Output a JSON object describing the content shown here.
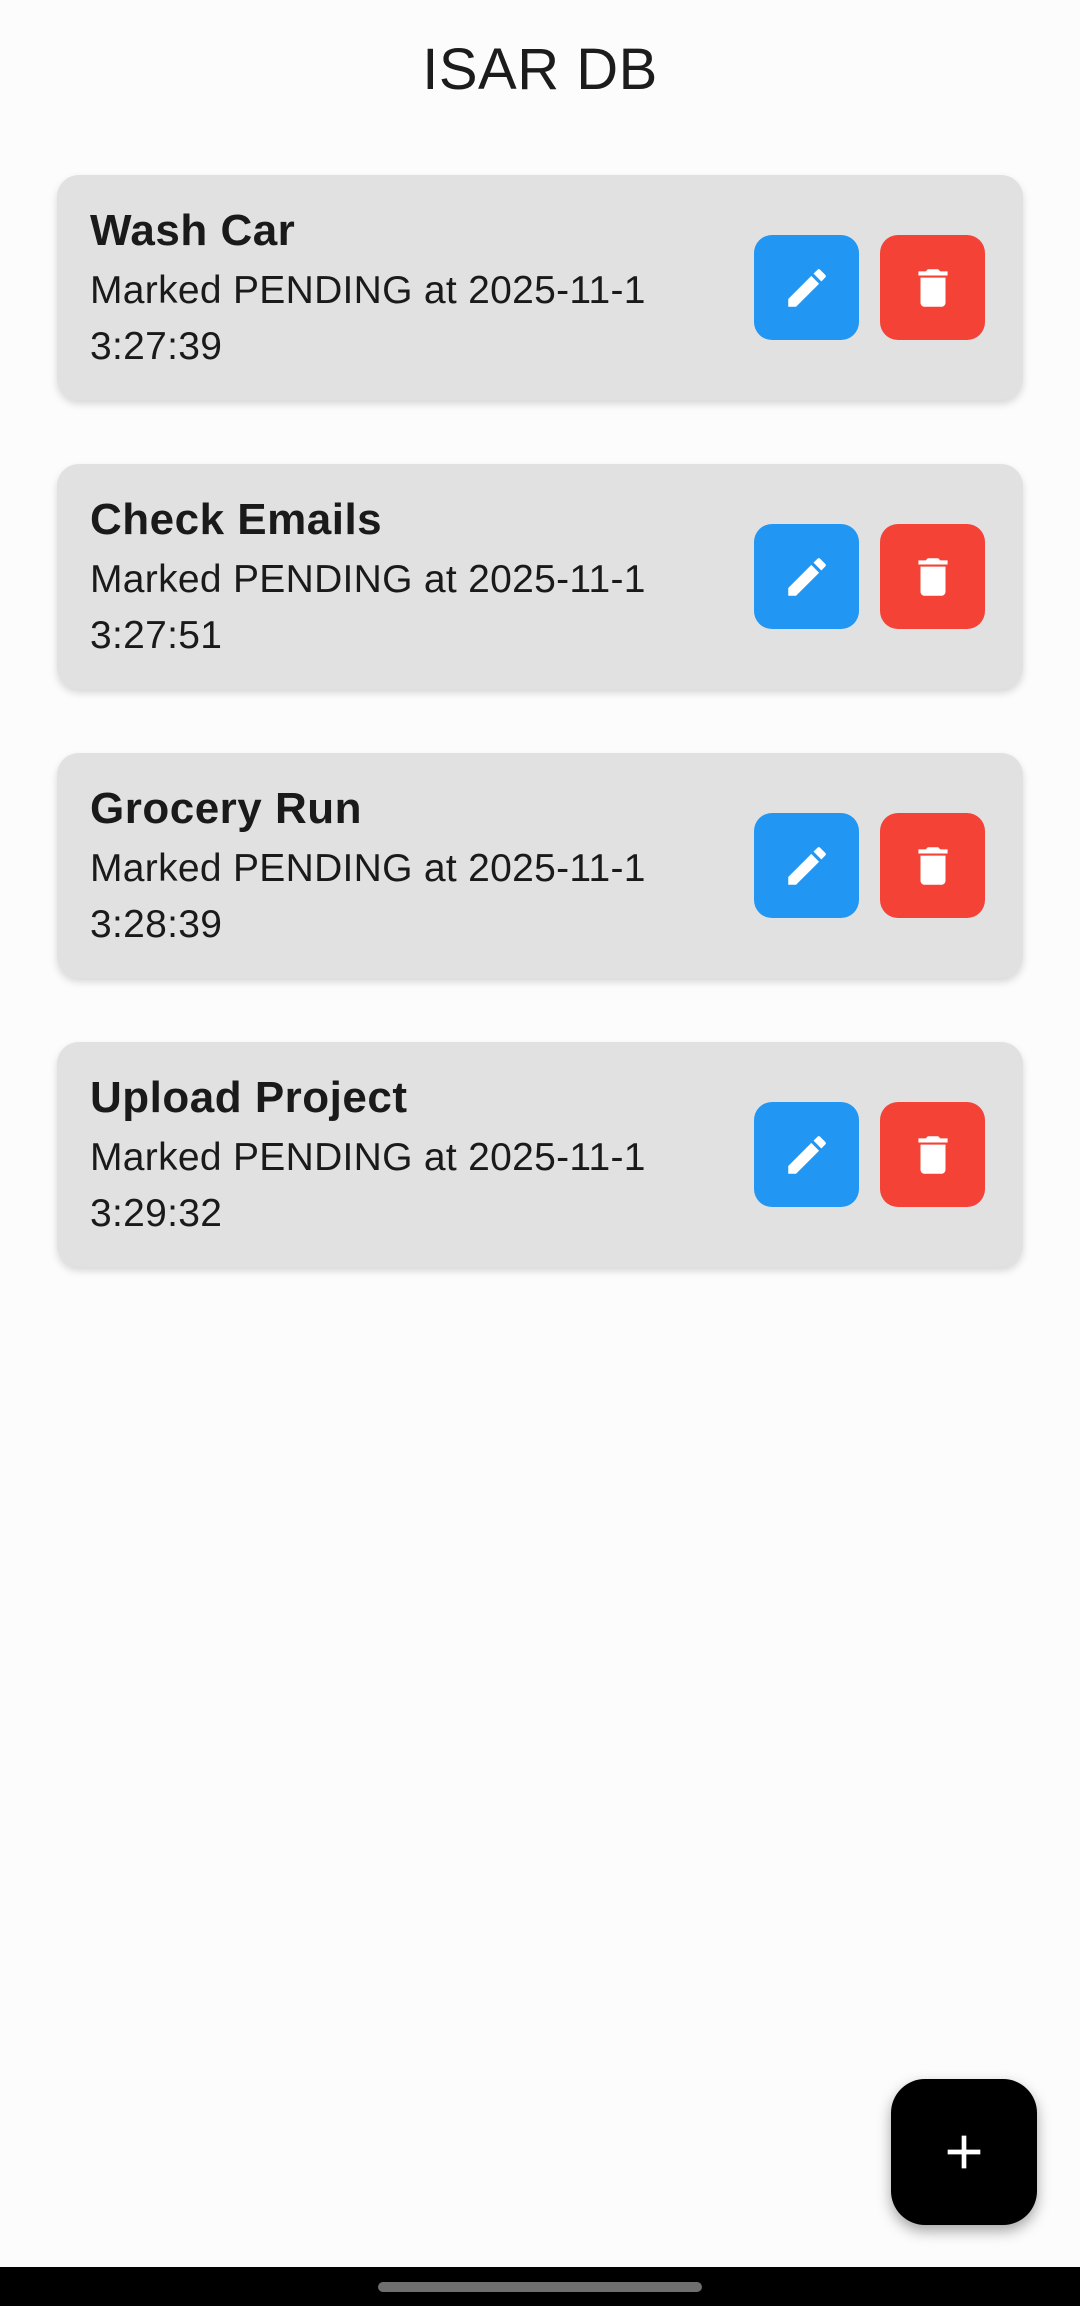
{
  "app": {
    "title": "ISAR DB"
  },
  "tasks": [
    {
      "title": "Wash Car",
      "subtitle": "Marked PENDING at 2025-11-1 3:27:39"
    },
    {
      "title": "Check Emails",
      "subtitle": "Marked PENDING at 2025-11-1 3:27:51"
    },
    {
      "title": "Grocery Run",
      "subtitle": "Marked PENDING at 2025-11-1 3:28:39"
    },
    {
      "title": "Upload Project",
      "subtitle": "Marked PENDING at 2025-11-1 3:29:32"
    }
  ],
  "icons": {
    "edit": "pencil-icon",
    "delete": "trash-icon",
    "add": "plus-icon"
  },
  "colors": {
    "edit_button": "#2196f3",
    "delete_button": "#f44336",
    "card_background": "#e1e1e1",
    "fab_background": "#000000"
  }
}
